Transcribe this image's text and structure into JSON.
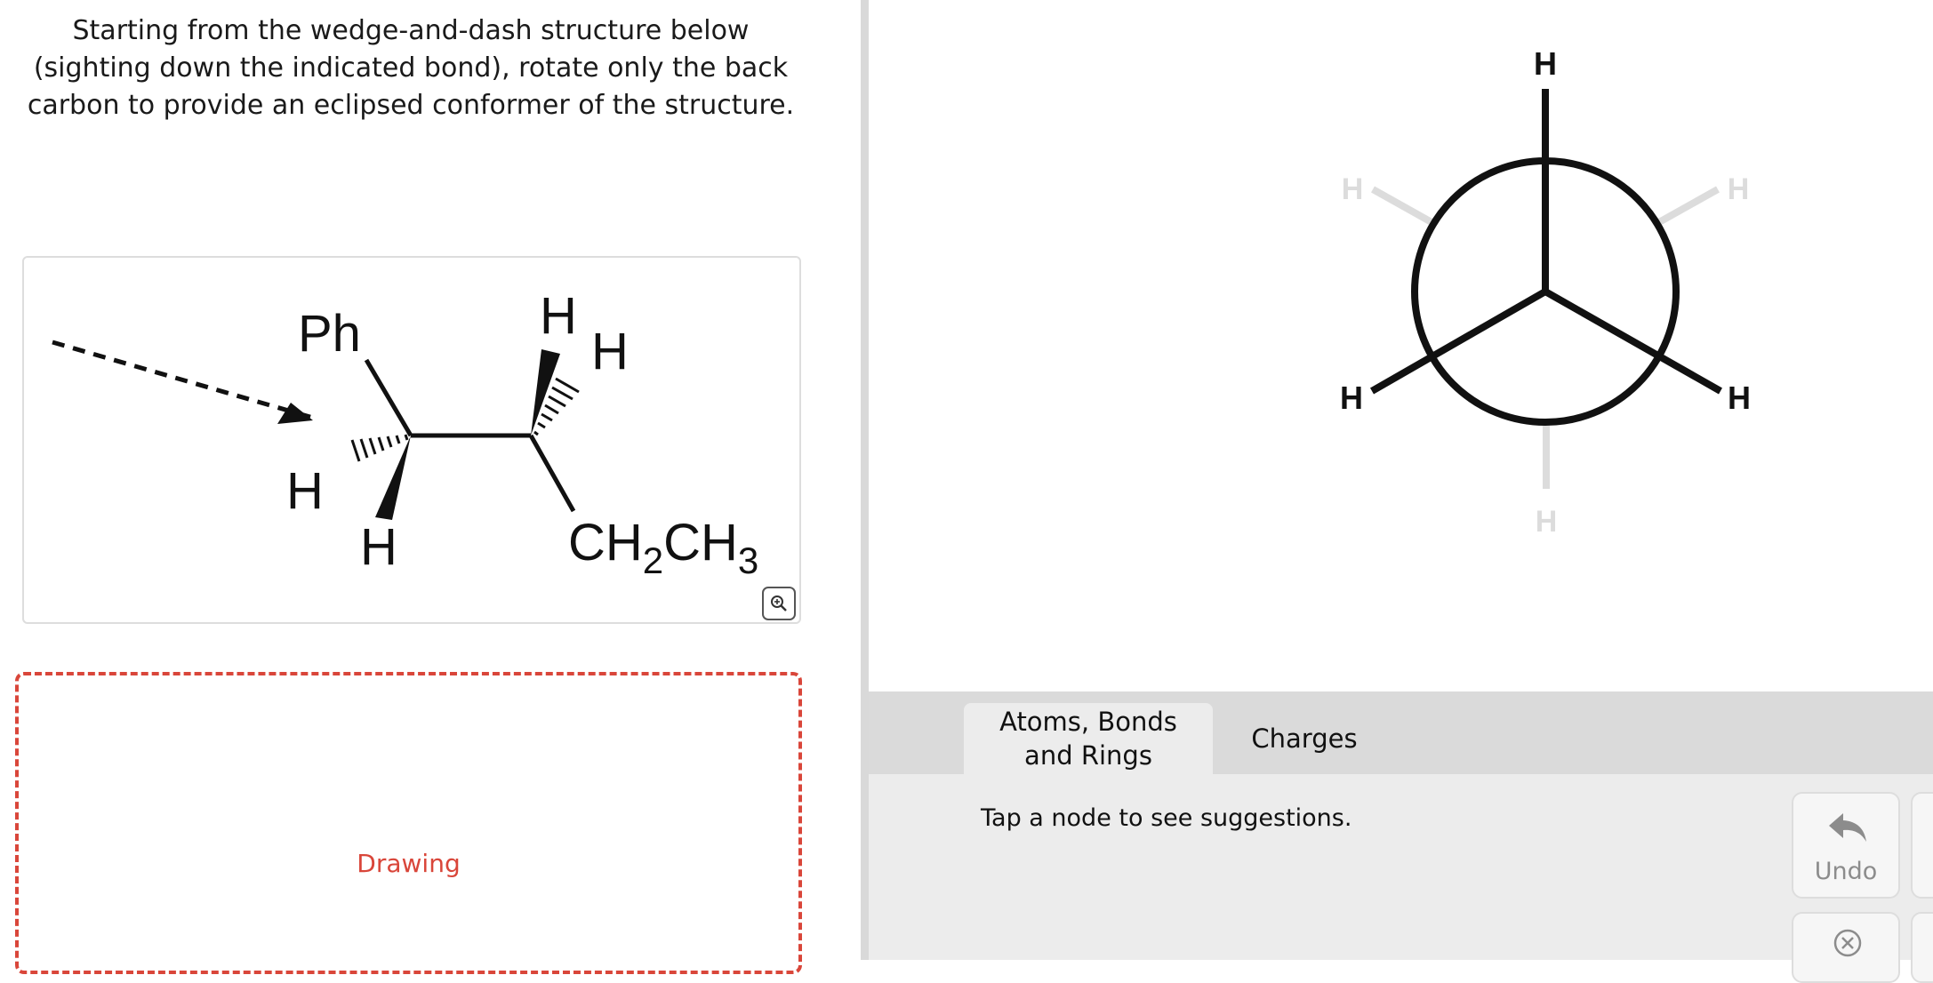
{
  "question": {
    "text": "Starting from the wedge-and-dash structure below (sighting down the indicated bond), rotate only the back carbon to provide an eclipsed conformer of the structure."
  },
  "structure": {
    "labels": {
      "ph": "Ph",
      "h_dash_left": "H",
      "h_wedge_left": "H",
      "h_wedge_right": "H",
      "h_dash_right": "H",
      "ch2ch3_c": "CH",
      "ch2ch3_sub2": "2",
      "ch2ch3_ch": "CH",
      "ch2ch3_sub3": "3"
    }
  },
  "drawing": {
    "label": "Drawing"
  },
  "newman": {
    "front_top": "H",
    "front_left": "H",
    "front_right": "H",
    "back_top_left": "H",
    "back_top_right": "H",
    "back_bottom": "H"
  },
  "toolbar": {
    "tabs": [
      {
        "label_line1": "Atoms, Bonds",
        "label_line2": "and Rings"
      },
      {
        "label": "Charges"
      }
    ]
  },
  "tool_panel": {
    "hint": "Tap a node to see suggestions.",
    "undo_label": "Undo"
  },
  "colors": {
    "accent_red": "#d9463a",
    "back_bond_gray": "#dcdcdc",
    "toolbar_bg": "#dadada",
    "panel_bg": "#ececec"
  },
  "icons": [
    "zoom-in-icon",
    "undo-arrow-icon",
    "clear-x-icon"
  ]
}
